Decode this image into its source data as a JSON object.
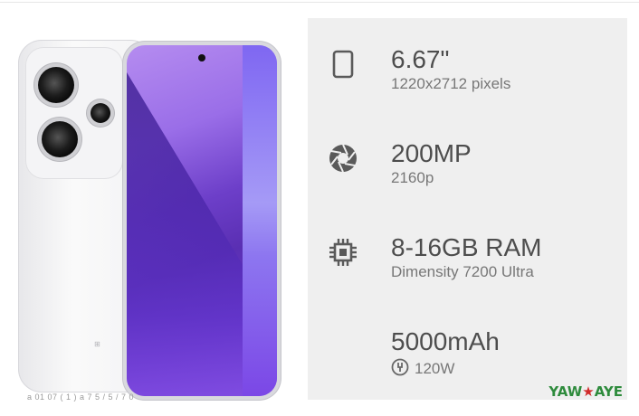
{
  "product": {
    "image_caption": "a 01 07 ( 1 )  a 7 5 / 5 / 7 0"
  },
  "specs": [
    {
      "icon": "phone-outline-icon",
      "title": "6.67\"",
      "subtitle": "1220x2712 pixels"
    },
    {
      "icon": "camera-aperture-icon",
      "title": "200MP",
      "subtitle": "2160p"
    },
    {
      "icon": "processor-chip-icon",
      "title": "8-16GB RAM",
      "subtitle": "Dimensity 7200 Ultra"
    },
    {
      "icon": "battery-charging-icon",
      "title": "5000mAh",
      "subtitle": "120W"
    }
  ],
  "watermark": {
    "part1": "YAW",
    "star": "★",
    "part2": "AYE"
  },
  "colors": {
    "panel_bg": "#efefef",
    "text_main": "#4d4d4d",
    "text_sub": "#777777",
    "watermark_green": "#2e8b3c",
    "watermark_red": "#d12a2a"
  }
}
